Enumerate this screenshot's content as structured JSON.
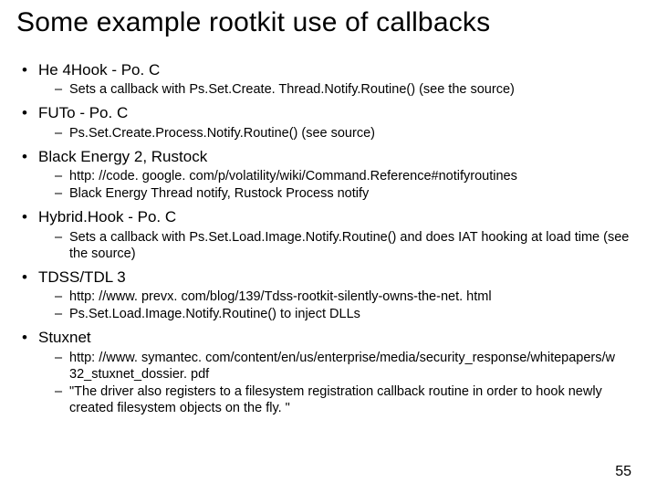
{
  "title": "Some example rootkit use of callbacks",
  "items": [
    {
      "label": "He 4Hook - Po. C",
      "sub": [
        "Sets a callback with Ps.Set.Create. Thread.Notify.Routine() (see the source)"
      ]
    },
    {
      "label": "FUTo - Po. C",
      "sub": [
        "Ps.Set.Create.Process.Notify.Routine() (see source)"
      ]
    },
    {
      "label": "Black Energy 2, Rustock",
      "sub": [
        "http: //code. google. com/p/volatility/wiki/Command.Reference#notifyroutines",
        "Black Energy Thread notify, Rustock Process notify"
      ]
    },
    {
      "label": "Hybrid.Hook - Po. C",
      "sub": [
        "Sets a callback with Ps.Set.Load.Image.Notify.Routine() and does IAT hooking at load time (see the source)"
      ]
    },
    {
      "label": "TDSS/TDL 3",
      "sub": [
        "http: //www. prevx. com/blog/139/Tdss-rootkit-silently-owns-the-net. html",
        "Ps.Set.Load.Image.Notify.Routine() to inject DLLs"
      ]
    },
    {
      "label": "Stuxnet",
      "sub": [
        "http: //www. symantec. com/content/en/us/enterprise/media/security_response/whitepapers/w 32_stuxnet_dossier. pdf",
        "\"The driver also registers to a filesystem registration callback routine in order to hook newly created filesystem objects on the fly. \""
      ]
    }
  ],
  "page_number": "55"
}
